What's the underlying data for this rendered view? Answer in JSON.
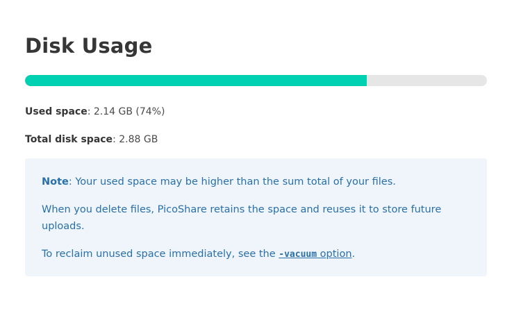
{
  "page": {
    "title": "Disk Usage"
  },
  "usage": {
    "used_fraction": 0.74,
    "used_label": "Used space",
    "used_value": "2.14 GB (74%)",
    "total_label": "Total disk space",
    "total_value": "2.88 GB"
  },
  "note": {
    "label": "Note",
    "line1": "Your used space may be higher than the sum total of your files.",
    "line2": "When you delete files, PicoShare retains the space and reuses it to store future uploads.",
    "line3_prefix": "To reclaim unused space immediately, see the ",
    "link_code": "-vacuum",
    "link_text": " option",
    "line3_suffix": "."
  },
  "colors": {
    "progress_fill": "#00d1b2",
    "progress_track": "#e6e6e6",
    "note_bg": "#eff5fb",
    "note_text": "#296fa8"
  }
}
